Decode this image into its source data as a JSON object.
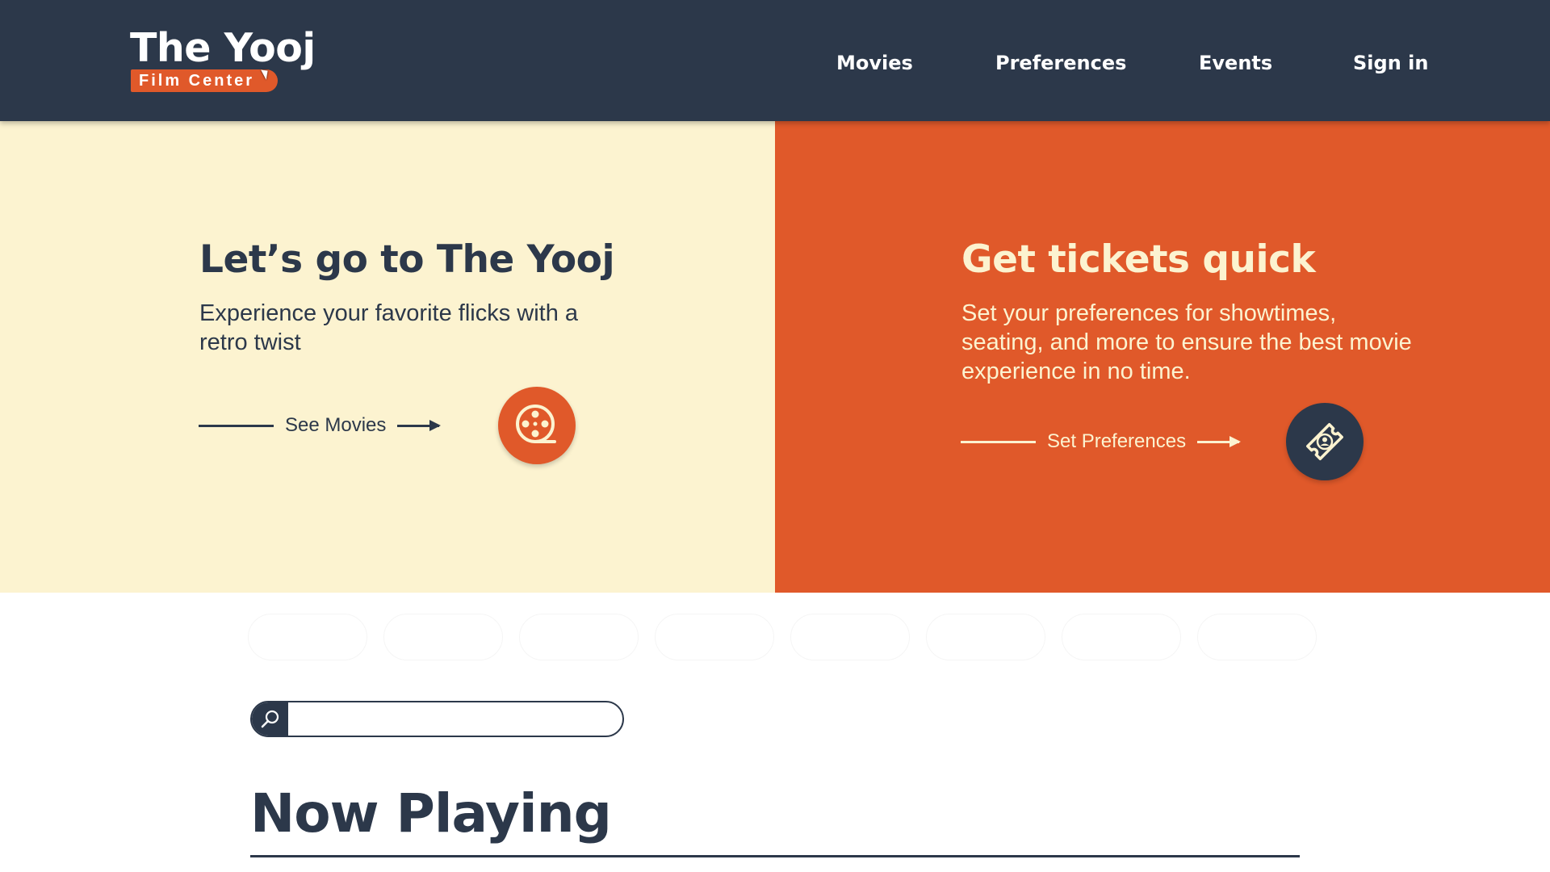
{
  "header": {
    "logo_title": "The Yooj",
    "logo_subtitle": "Film Center",
    "nav": [
      "Movies",
      "Preferences",
      "Events",
      "Sign in"
    ]
  },
  "hero_left": {
    "title": "Let’s go to The Yooj",
    "text": "Experience your favorite flicks with a retro twist",
    "cta_label": "See Movies",
    "icon": "film-reel-icon"
  },
  "hero_right": {
    "title": "Get tickets quick",
    "text": "Set your preferences for showtimes, seating, and more to ensure the best movie experience in no time.",
    "cta_label": "Set Preferences",
    "icon": "ticket-icon"
  },
  "search": {
    "placeholder": "",
    "icon": "search-icon"
  },
  "section": {
    "title": "Now Playing"
  },
  "colors": {
    "navy": "#2c384a",
    "orange": "#e0592a",
    "cream": "#fcf3d0",
    "white": "#ffffff"
  }
}
